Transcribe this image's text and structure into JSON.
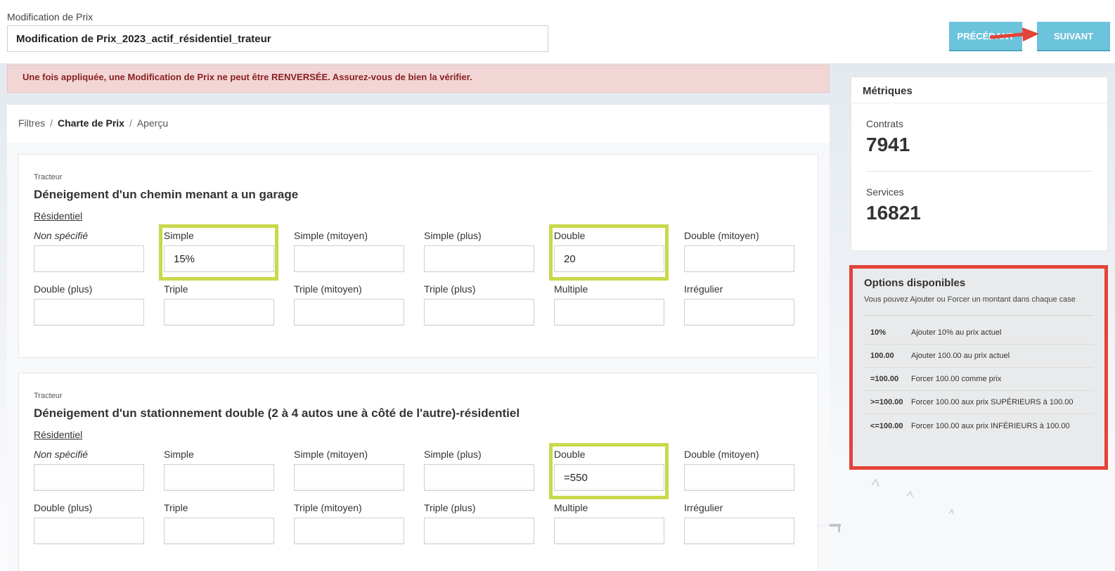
{
  "header": {
    "name_label": "Modification de Prix",
    "name_value": "Modification de Prix_2023_actif_résidentiel_trateur",
    "prev_label": "PRÉCÉDANT",
    "next_label": "SUIVANT"
  },
  "alert": {
    "text": "Une fois appliquée, une Modification de Prix ne peut être RENVERSÉE. Assurez-vous de bien la vérifier."
  },
  "breadcrumb": {
    "items": [
      "Filtres",
      "Charte de Prix",
      "Aperçu"
    ],
    "separator": "/"
  },
  "services": [
    {
      "category": "Tracteur",
      "title": "Déneigement d'un chemin menant a un garage",
      "subtitle": "Résidentiel",
      "fields": [
        {
          "label": "Non spécifié",
          "value": ""
        },
        {
          "label": "Simple",
          "value": "15%"
        },
        {
          "label": "Simple (mitoyen)",
          "value": ""
        },
        {
          "label": "Simple (plus)",
          "value": ""
        },
        {
          "label": "Double",
          "value": "20"
        },
        {
          "label": "Double (mitoyen)",
          "value": ""
        },
        {
          "label": "Double (plus)",
          "value": ""
        },
        {
          "label": "Triple",
          "value": ""
        },
        {
          "label": "Triple (mitoyen)",
          "value": ""
        },
        {
          "label": "Triple (plus)",
          "value": ""
        },
        {
          "label": "Multiple",
          "value": ""
        },
        {
          "label": "Irrégulier",
          "value": ""
        }
      ]
    },
    {
      "category": "Tracteur",
      "title": "Déneigement d'un stationnement double (2 à 4 autos une à côté de l'autre)-résidentiel",
      "subtitle": "Résidentiel",
      "fields": [
        {
          "label": "Non spécifié",
          "value": ""
        },
        {
          "label": "Simple",
          "value": ""
        },
        {
          "label": "Simple (mitoyen)",
          "value": ""
        },
        {
          "label": "Simple (plus)",
          "value": ""
        },
        {
          "label": "Double",
          "value": "=550"
        },
        {
          "label": "Double (mitoyen)",
          "value": ""
        },
        {
          "label": "Double (plus)",
          "value": ""
        },
        {
          "label": "Triple",
          "value": ""
        },
        {
          "label": "Triple (mitoyen)",
          "value": ""
        },
        {
          "label": "Triple (plus)",
          "value": ""
        },
        {
          "label": "Multiple",
          "value": ""
        },
        {
          "label": "Irrégulier",
          "value": ""
        }
      ]
    }
  ],
  "metrics": {
    "title": "Métriques",
    "contracts_label": "Contrats",
    "contracts_value": "7941",
    "services_label": "Services",
    "services_value": "16821"
  },
  "options": {
    "title": "Options disponibles",
    "description": "Vous pouvez Ajouter ou Forcer un montant dans chaque case",
    "rows": [
      {
        "code": "10%",
        "text": "Ajouter 10% au prix actuel"
      },
      {
        "code": "100.00",
        "text": "Ajouter 100.00 au prix actuel"
      },
      {
        "code": "=100.00",
        "text": "Forcer 100.00 comme prix"
      },
      {
        "code": ">=100.00",
        "text": "Forcer 100.00 aux prix SUPÉRIEURS à 100.00"
      },
      {
        "code": "<=100.00",
        "text": "Forcer 100.00 aux prix INFÉRIEURS à 100.00"
      }
    ]
  },
  "colors": {
    "button": "#6cc3dc",
    "alert_bg": "#f2d6d6",
    "alert_text": "#8a1f1f",
    "highlight_green": "#c8d94a",
    "highlight_red": "#e34339"
  }
}
